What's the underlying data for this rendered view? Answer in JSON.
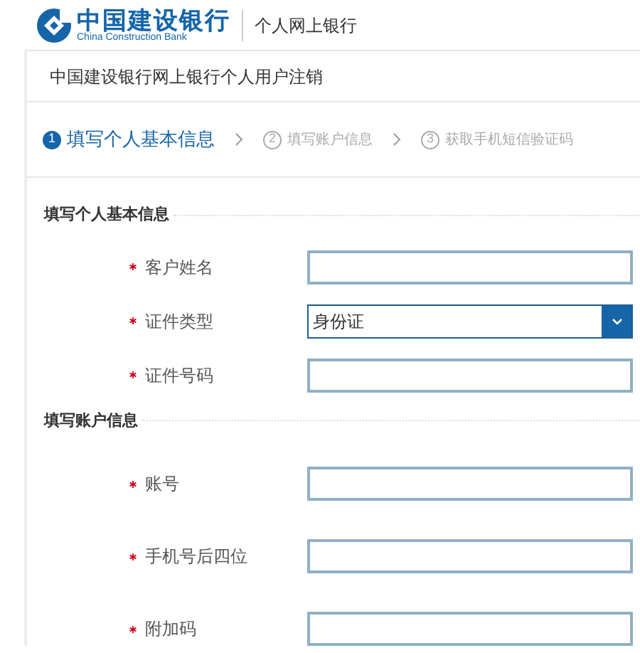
{
  "header": {
    "logo_name": "中国建设银行",
    "logo_english": "China Construction Bank",
    "product": "个人网上银行"
  },
  "page_title": "中国建设银行网上银行个人用户注销",
  "steps": [
    {
      "number": "1",
      "label": "填写个人基本信息",
      "selected": true
    },
    {
      "number": "2",
      "label": "填写账户信息",
      "selected": false
    },
    {
      "number": "3",
      "label": "获取手机短信验证码",
      "selected": false
    }
  ],
  "sections": [
    {
      "title": "填写个人基本信息",
      "fields": [
        {
          "kind": "text",
          "required": true,
          "label": "客户姓名"
        },
        {
          "kind": "select",
          "required": true,
          "label": "证件类型",
          "value": "身份证"
        },
        {
          "kind": "text",
          "required": true,
          "label": "证件号码"
        }
      ]
    },
    {
      "title": "填写账户信息",
      "fields": [
        {
          "kind": "text",
          "required": true,
          "label": "账号"
        },
        {
          "kind": "text",
          "required": true,
          "label": "手机号后四位"
        },
        {
          "kind": "text",
          "required": true,
          "label": "附加码"
        }
      ]
    }
  ]
}
